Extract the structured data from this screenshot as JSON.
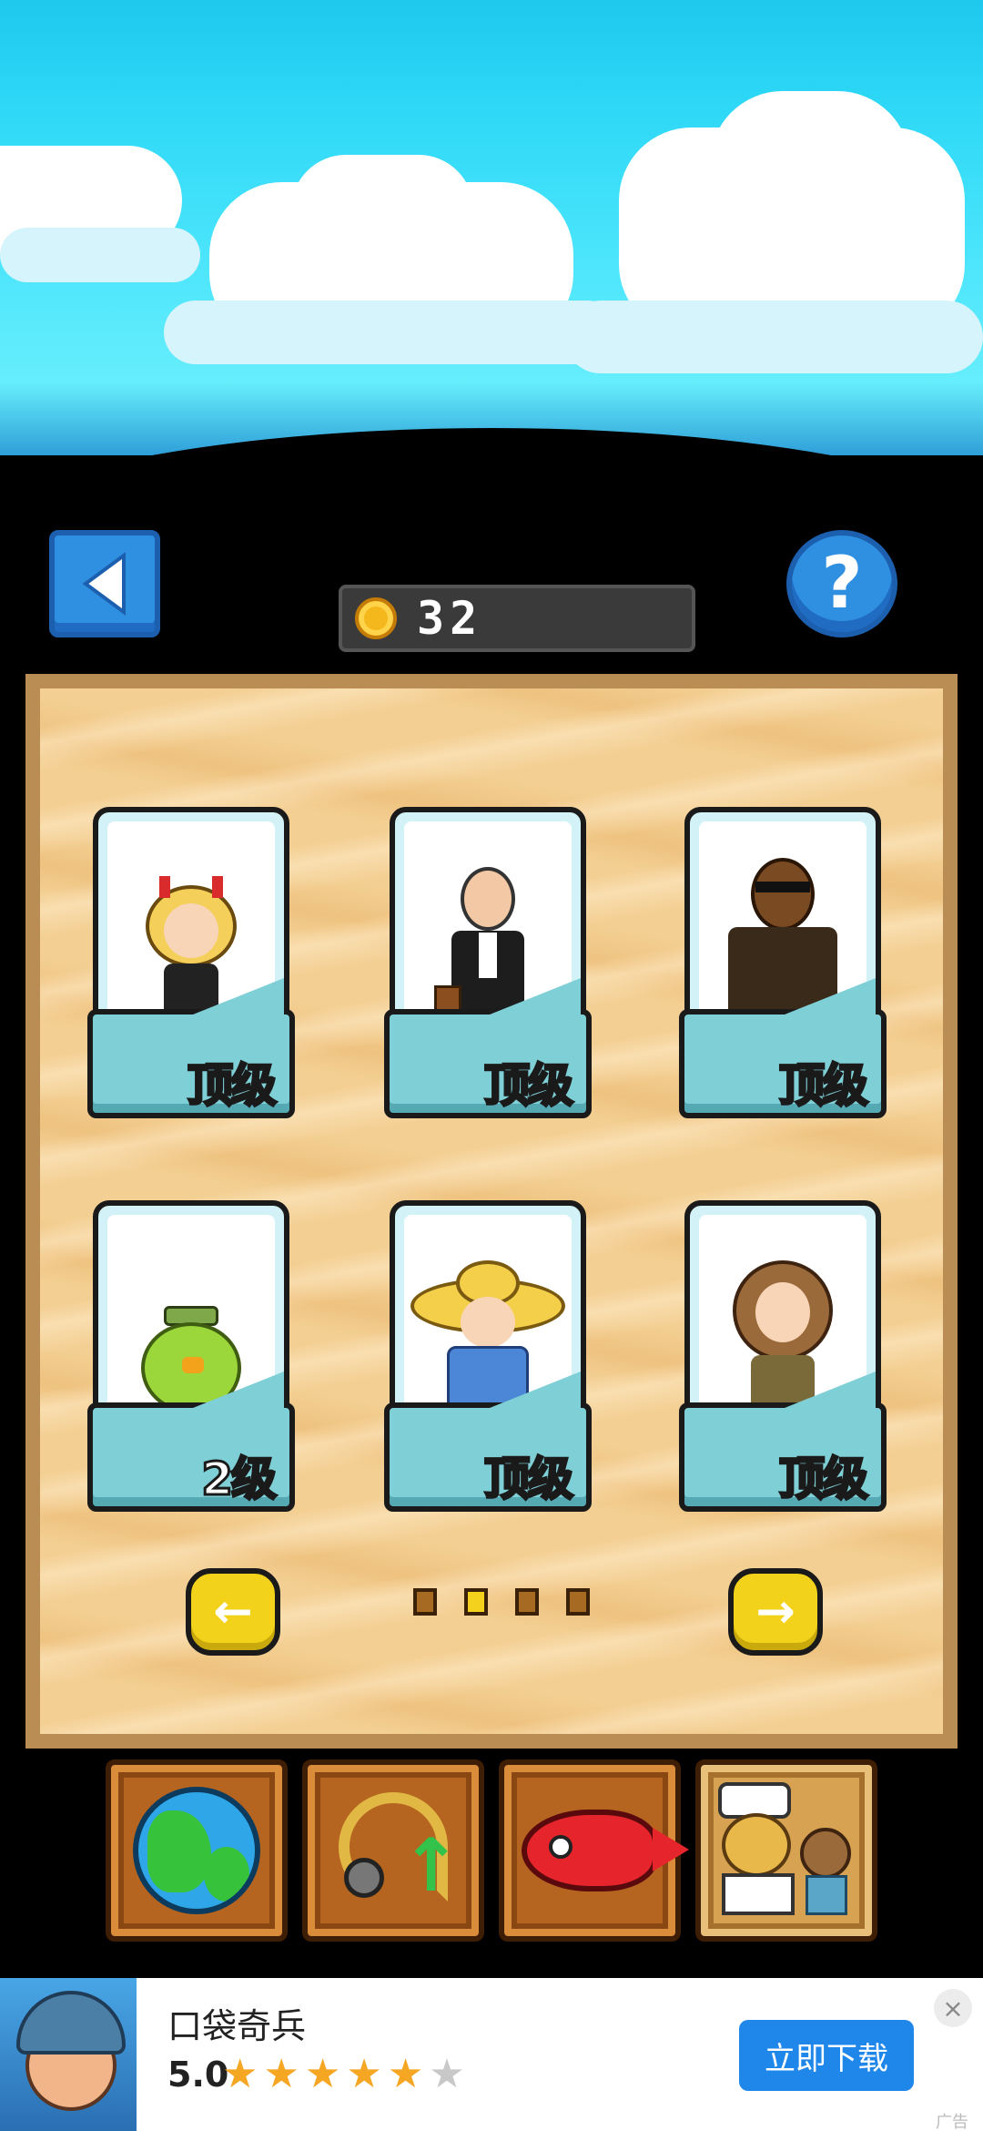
{
  "header": {
    "back_icon": "triangle-left",
    "help_label": "?",
    "coins": "32"
  },
  "cards": [
    {
      "level": "顶级",
      "character": "blonde-girl-with-horns"
    },
    {
      "level": "顶级",
      "character": "old-man-in-suit"
    },
    {
      "level": "顶级",
      "character": "bearded-man-with-sunglasses"
    },
    {
      "level_number": "2",
      "level_unit": "级",
      "character": "green-bird-with-hat"
    },
    {
      "level": "顶级",
      "character": "girl-with-straw-hat"
    },
    {
      "level": "顶级",
      "character": "brown-haired-girl"
    }
  ],
  "pagination": {
    "prev_icon": "arrow-left",
    "next_icon": "arrow-right",
    "pages": 4,
    "active_page": 2
  },
  "bottom_menu": [
    {
      "icon": "globe-icon"
    },
    {
      "icon": "fishing-rod-upgrade-icon"
    },
    {
      "icon": "red-fish-icon"
    },
    {
      "icon": "characters-icon",
      "active": true
    }
  ],
  "ad": {
    "title": "口袋奇兵",
    "rating": "5.0",
    "stars_filled": 5,
    "stars_total": 6,
    "button": "立即下载",
    "close": "×",
    "label": "广告"
  },
  "colors": {
    "sky": "#2ed8f6",
    "sand": "#f3cf93",
    "button_blue": "#2f8fe0",
    "level_gold": "#f6df2f",
    "ad_button": "#1f86ea"
  }
}
